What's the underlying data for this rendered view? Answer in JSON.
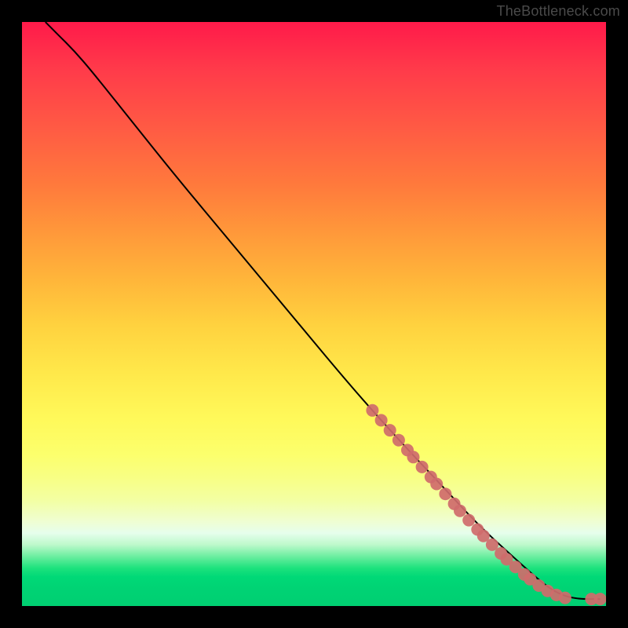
{
  "watermark": "TheBottleneck.com",
  "colors": {
    "dot": "#cf6b6b",
    "curve": "#000000",
    "frame": "#000000"
  },
  "chart_data": {
    "type": "line",
    "title": "",
    "xlabel": "",
    "ylabel": "",
    "xlim": [
      0,
      100
    ],
    "ylim": [
      0,
      100
    ],
    "grid": false,
    "legend": false,
    "curve": [
      {
        "x": 4,
        "y": 100
      },
      {
        "x": 6,
        "y": 98
      },
      {
        "x": 9,
        "y": 95
      },
      {
        "x": 12,
        "y": 91.5
      },
      {
        "x": 18,
        "y": 84
      },
      {
        "x": 26,
        "y": 74
      },
      {
        "x": 36,
        "y": 62
      },
      {
        "x": 46,
        "y": 50
      },
      {
        "x": 56,
        "y": 38
      },
      {
        "x": 64,
        "y": 29
      },
      {
        "x": 72,
        "y": 20.5
      },
      {
        "x": 78,
        "y": 14
      },
      {
        "x": 84,
        "y": 8.5
      },
      {
        "x": 89,
        "y": 4
      },
      {
        "x": 92,
        "y": 2
      },
      {
        "x": 95,
        "y": 1.2
      },
      {
        "x": 99,
        "y": 1.2
      }
    ],
    "dots": [
      {
        "x": 60,
        "y": 33.5
      },
      {
        "x": 61.5,
        "y": 31.8
      },
      {
        "x": 63,
        "y": 30.1
      },
      {
        "x": 64.5,
        "y": 28.4
      },
      {
        "x": 66,
        "y": 26.7
      },
      {
        "x": 67,
        "y": 25.5
      },
      {
        "x": 68.5,
        "y": 23.8
      },
      {
        "x": 70,
        "y": 22.1
      },
      {
        "x": 71,
        "y": 20.9
      },
      {
        "x": 72.5,
        "y": 19.2
      },
      {
        "x": 74,
        "y": 17.5
      },
      {
        "x": 75,
        "y": 16.3
      },
      {
        "x": 76.5,
        "y": 14.7
      },
      {
        "x": 78,
        "y": 13.1
      },
      {
        "x": 79,
        "y": 12
      },
      {
        "x": 80.5,
        "y": 10.5
      },
      {
        "x": 82,
        "y": 9
      },
      {
        "x": 83,
        "y": 8
      },
      {
        "x": 84.5,
        "y": 6.7
      },
      {
        "x": 86,
        "y": 5.4
      },
      {
        "x": 87,
        "y": 4.6
      },
      {
        "x": 88.5,
        "y": 3.5
      },
      {
        "x": 90,
        "y": 2.6
      },
      {
        "x": 91.5,
        "y": 1.9
      },
      {
        "x": 93,
        "y": 1.4
      },
      {
        "x": 97.5,
        "y": 1.2
      },
      {
        "x": 99,
        "y": 1.2
      }
    ]
  }
}
